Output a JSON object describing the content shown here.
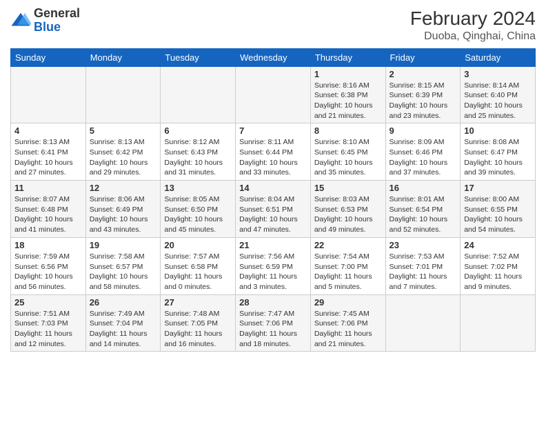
{
  "logo": {
    "general": "General",
    "blue": "Blue"
  },
  "title": "February 2024",
  "subtitle": "Duoba, Qinghai, China",
  "weekdays": [
    "Sunday",
    "Monday",
    "Tuesday",
    "Wednesday",
    "Thursday",
    "Friday",
    "Saturday"
  ],
  "weeks": [
    [
      {
        "day": "",
        "info": ""
      },
      {
        "day": "",
        "info": ""
      },
      {
        "day": "",
        "info": ""
      },
      {
        "day": "",
        "info": ""
      },
      {
        "day": "1",
        "info": "Sunrise: 8:16 AM\nSunset: 6:38 PM\nDaylight: 10 hours and 21 minutes."
      },
      {
        "day": "2",
        "info": "Sunrise: 8:15 AM\nSunset: 6:39 PM\nDaylight: 10 hours and 23 minutes."
      },
      {
        "day": "3",
        "info": "Sunrise: 8:14 AM\nSunset: 6:40 PM\nDaylight: 10 hours and 25 minutes."
      }
    ],
    [
      {
        "day": "4",
        "info": "Sunrise: 8:13 AM\nSunset: 6:41 PM\nDaylight: 10 hours and 27 minutes."
      },
      {
        "day": "5",
        "info": "Sunrise: 8:13 AM\nSunset: 6:42 PM\nDaylight: 10 hours and 29 minutes."
      },
      {
        "day": "6",
        "info": "Sunrise: 8:12 AM\nSunset: 6:43 PM\nDaylight: 10 hours and 31 minutes."
      },
      {
        "day": "7",
        "info": "Sunrise: 8:11 AM\nSunset: 6:44 PM\nDaylight: 10 hours and 33 minutes."
      },
      {
        "day": "8",
        "info": "Sunrise: 8:10 AM\nSunset: 6:45 PM\nDaylight: 10 hours and 35 minutes."
      },
      {
        "day": "9",
        "info": "Sunrise: 8:09 AM\nSunset: 6:46 PM\nDaylight: 10 hours and 37 minutes."
      },
      {
        "day": "10",
        "info": "Sunrise: 8:08 AM\nSunset: 6:47 PM\nDaylight: 10 hours and 39 minutes."
      }
    ],
    [
      {
        "day": "11",
        "info": "Sunrise: 8:07 AM\nSunset: 6:48 PM\nDaylight: 10 hours and 41 minutes."
      },
      {
        "day": "12",
        "info": "Sunrise: 8:06 AM\nSunset: 6:49 PM\nDaylight: 10 hours and 43 minutes."
      },
      {
        "day": "13",
        "info": "Sunrise: 8:05 AM\nSunset: 6:50 PM\nDaylight: 10 hours and 45 minutes."
      },
      {
        "day": "14",
        "info": "Sunrise: 8:04 AM\nSunset: 6:51 PM\nDaylight: 10 hours and 47 minutes."
      },
      {
        "day": "15",
        "info": "Sunrise: 8:03 AM\nSunset: 6:53 PM\nDaylight: 10 hours and 49 minutes."
      },
      {
        "day": "16",
        "info": "Sunrise: 8:01 AM\nSunset: 6:54 PM\nDaylight: 10 hours and 52 minutes."
      },
      {
        "day": "17",
        "info": "Sunrise: 8:00 AM\nSunset: 6:55 PM\nDaylight: 10 hours and 54 minutes."
      }
    ],
    [
      {
        "day": "18",
        "info": "Sunrise: 7:59 AM\nSunset: 6:56 PM\nDaylight: 10 hours and 56 minutes."
      },
      {
        "day": "19",
        "info": "Sunrise: 7:58 AM\nSunset: 6:57 PM\nDaylight: 10 hours and 58 minutes."
      },
      {
        "day": "20",
        "info": "Sunrise: 7:57 AM\nSunset: 6:58 PM\nDaylight: 11 hours and 0 minutes."
      },
      {
        "day": "21",
        "info": "Sunrise: 7:56 AM\nSunset: 6:59 PM\nDaylight: 11 hours and 3 minutes."
      },
      {
        "day": "22",
        "info": "Sunrise: 7:54 AM\nSunset: 7:00 PM\nDaylight: 11 hours and 5 minutes."
      },
      {
        "day": "23",
        "info": "Sunrise: 7:53 AM\nSunset: 7:01 PM\nDaylight: 11 hours and 7 minutes."
      },
      {
        "day": "24",
        "info": "Sunrise: 7:52 AM\nSunset: 7:02 PM\nDaylight: 11 hours and 9 minutes."
      }
    ],
    [
      {
        "day": "25",
        "info": "Sunrise: 7:51 AM\nSunset: 7:03 PM\nDaylight: 11 hours and 12 minutes."
      },
      {
        "day": "26",
        "info": "Sunrise: 7:49 AM\nSunset: 7:04 PM\nDaylight: 11 hours and 14 minutes."
      },
      {
        "day": "27",
        "info": "Sunrise: 7:48 AM\nSunset: 7:05 PM\nDaylight: 11 hours and 16 minutes."
      },
      {
        "day": "28",
        "info": "Sunrise: 7:47 AM\nSunset: 7:06 PM\nDaylight: 11 hours and 18 minutes."
      },
      {
        "day": "29",
        "info": "Sunrise: 7:45 AM\nSunset: 7:06 PM\nDaylight: 11 hours and 21 minutes."
      },
      {
        "day": "",
        "info": ""
      },
      {
        "day": "",
        "info": ""
      }
    ]
  ]
}
